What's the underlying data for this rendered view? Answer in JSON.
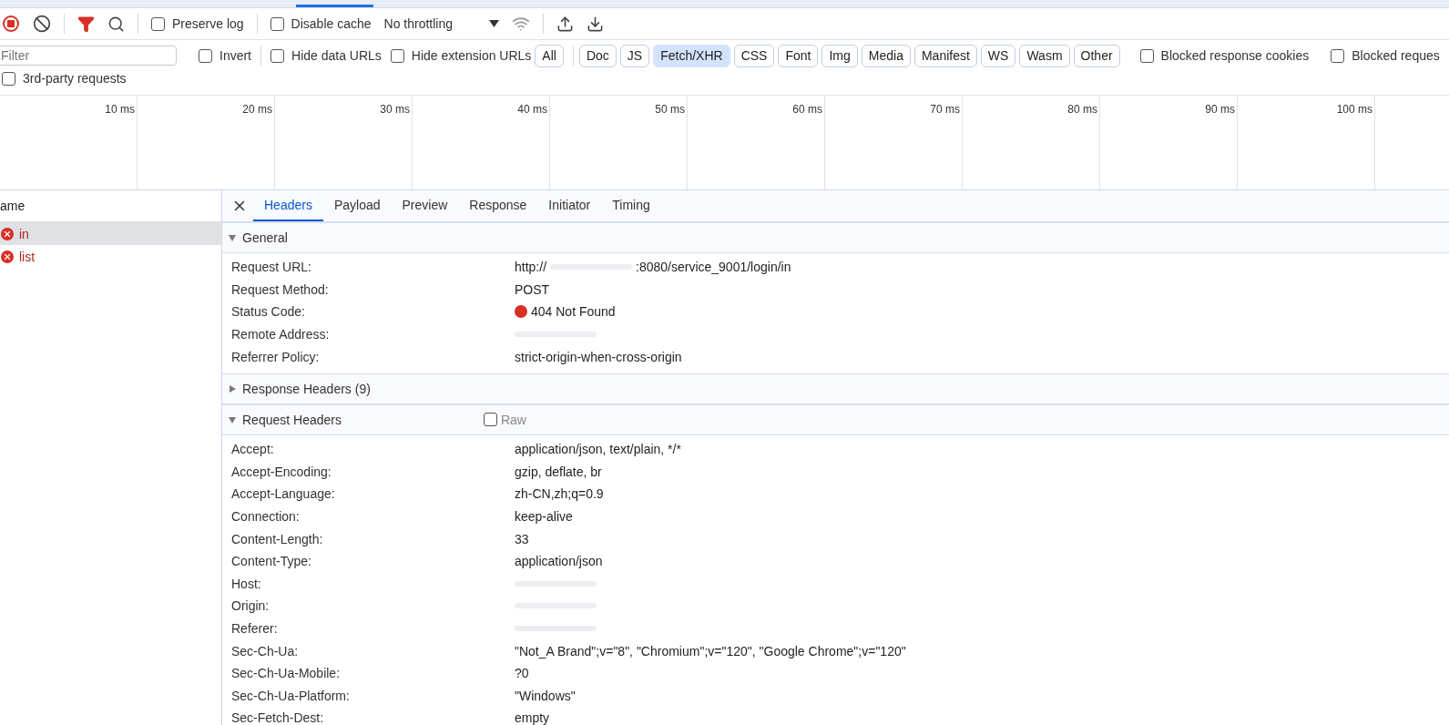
{
  "toolbar": {
    "preserve_log": {
      "label": "Preserve log",
      "checked": false
    },
    "disable_cache": {
      "label": "Disable cache",
      "checked": false
    },
    "throttling": "No throttling"
  },
  "filter_bar": {
    "placeholder": "Filter",
    "invert": {
      "label": "Invert",
      "checked": false
    },
    "hide_data_urls": {
      "label": "Hide data URLs",
      "checked": false
    },
    "hide_extension_urls": {
      "label": "Hide extension URLs",
      "checked": false
    },
    "types": [
      {
        "label": "All",
        "selected": false
      },
      {
        "label": "Doc",
        "selected": false
      },
      {
        "label": "JS",
        "selected": false
      },
      {
        "label": "Fetch/XHR",
        "selected": true
      },
      {
        "label": "CSS",
        "selected": false
      },
      {
        "label": "Font",
        "selected": false
      },
      {
        "label": "Img",
        "selected": false
      },
      {
        "label": "Media",
        "selected": false
      },
      {
        "label": "Manifest",
        "selected": false
      },
      {
        "label": "WS",
        "selected": false
      },
      {
        "label": "Wasm",
        "selected": false
      },
      {
        "label": "Other",
        "selected": false
      }
    ],
    "blocked_response_cookies": {
      "label": "Blocked response cookies",
      "checked": false
    },
    "blocked_requests": {
      "label": "Blocked reques",
      "checked": false
    },
    "third_party": {
      "label": "3rd-party requests",
      "checked": false
    }
  },
  "timeline": {
    "ticks": [
      "10 ms",
      "20 ms",
      "30 ms",
      "40 ms",
      "50 ms",
      "60 ms",
      "70 ms",
      "80 ms",
      "90 ms",
      "100 ms"
    ]
  },
  "requests": {
    "column": "ame",
    "items": [
      {
        "name": "in",
        "selected": true,
        "failed": true
      },
      {
        "name": "list",
        "selected": false,
        "failed": true
      }
    ]
  },
  "details": {
    "tabs": [
      {
        "label": "Headers",
        "selected": true
      },
      {
        "label": "Payload",
        "selected": false
      },
      {
        "label": "Preview",
        "selected": false
      },
      {
        "label": "Response",
        "selected": false
      },
      {
        "label": "Initiator",
        "selected": false
      },
      {
        "label": "Timing",
        "selected": false
      }
    ],
    "sections": [
      {
        "title": "General",
        "expanded": true,
        "rows": [
          {
            "name": "Request URL:",
            "value": "http://",
            "value_end": ":8080/service_9001/login/in",
            "redacted": true
          },
          {
            "name": "Request Method:",
            "value": "POST"
          },
          {
            "name": "Status Code:",
            "value": "404 Not Found",
            "color": "#d93025"
          },
          {
            "name": "Remote Address:",
            "redacted": true
          },
          {
            "name": "Referrer Policy:",
            "value": "strict-origin-when-cross-origin"
          }
        ]
      },
      {
        "title": "Response Headers (9)",
        "expanded": false
      },
      {
        "title": "Request Headers",
        "expanded": true,
        "raw": {
          "label": "Raw",
          "checked": false
        },
        "rows": [
          {
            "name": "Accept:",
            "value": "application/json, text/plain, */*"
          },
          {
            "name": "Accept-Encoding:",
            "value": "gzip, deflate, br"
          },
          {
            "name": "Accept-Language:",
            "value": "zh-CN,zh;q=0.9"
          },
          {
            "name": "Connection:",
            "value": "keep-alive"
          },
          {
            "name": "Content-Length:",
            "value": "33"
          },
          {
            "name": "Content-Type:",
            "value": "application/json"
          },
          {
            "name": "Host:",
            "redacted": true
          },
          {
            "name": "Origin:",
            "redacted": true
          },
          {
            "name": "Referer:",
            "redacted": true
          },
          {
            "name": "Sec-Ch-Ua:",
            "value": "\"Not_A Brand\";v=\"8\", \"Chromium\";v=\"120\", \"Google Chrome\";v=\"120\""
          },
          {
            "name": "Sec-Ch-Ua-Mobile:",
            "value": "?0"
          },
          {
            "name": "Sec-Ch-Ua-Platform:",
            "value": "\"Windows\""
          },
          {
            "name": "Sec-Fetch-Dest:",
            "value": "empty"
          }
        ]
      }
    ]
  }
}
